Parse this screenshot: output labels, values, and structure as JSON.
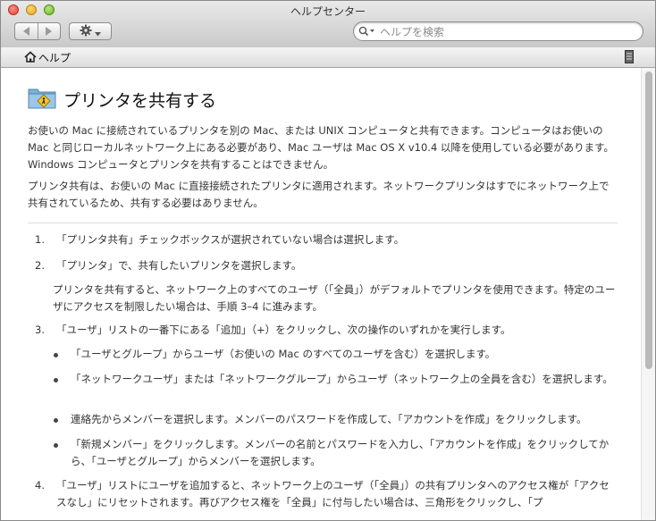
{
  "window": {
    "title": "ヘルプセンター"
  },
  "toolbar": {
    "search_placeholder": "ヘルプを検索"
  },
  "pathbar": {
    "home_label": "ヘルプ"
  },
  "article": {
    "title": "プリンタを共有する",
    "intro_1": "お使いの Mac に接続されているプリンタを別の Mac、または UNIX コンピュータと共有できます。コンピュータはお使いの Mac と同じローカルネットワーク上にある必要があり、Mac ユーザは Mac OS X v10.4 以降を使用している必要があります。Windows コンピュータとプリンタを共有することはできません。",
    "intro_2": "プリンタ共有は、お使いの Mac に直接接続されたプリンタに適用されます。ネットワークプリンタはすでにネットワーク上で共有されているため、共有する必要はありません。",
    "steps": [
      {
        "num": "1.",
        "text": "「プリンタ共有」チェックボックスが選択されていない場合は選択します。"
      },
      {
        "num": "2.",
        "text": "「プリンタ」で、共有したいプリンタを選択します。",
        "note": "プリンタを共有すると、ネットワーク上のすべてのユーザ（「全員」）がデフォルトでプリンタを使用できます。特定のユーザにアクセスを制限したい場合は、手順 3–4 に進みます。"
      },
      {
        "num": "3.",
        "text": "「ユーザ」リストの一番下にある「追加」（+）をクリックし、次の操作のいずれかを実行します。"
      },
      {
        "num": "4.",
        "text": "「ユーザ」リストにユーザを追加すると、ネットワーク上のユーザ（「全員」）の共有プリンタへのアクセス権が「アクセスなし」にリセットされます。再びアクセス権を「全員」に付与したい場合は、三角形をクリックし、「プ"
      }
    ],
    "bullets": [
      "「ユーザとグループ」からユーザ（お使いの Mac のすべてのユーザを含む）を選択します。",
      "「ネットワークユーザ」または「ネットワークグループ」からユーザ（ネットワーク上の全員を含む）を選択します。",
      "連絡先からメンバーを選択します。メンバーのパスワードを作成して、「アカウントを作成」をクリックします。",
      "「新規メンバー」をクリックします。メンバーの名前とパスワードを入力し、「アカウントを作成」をクリックしてから、「ユーザとグループ」からメンバーを選択します。"
    ]
  }
}
